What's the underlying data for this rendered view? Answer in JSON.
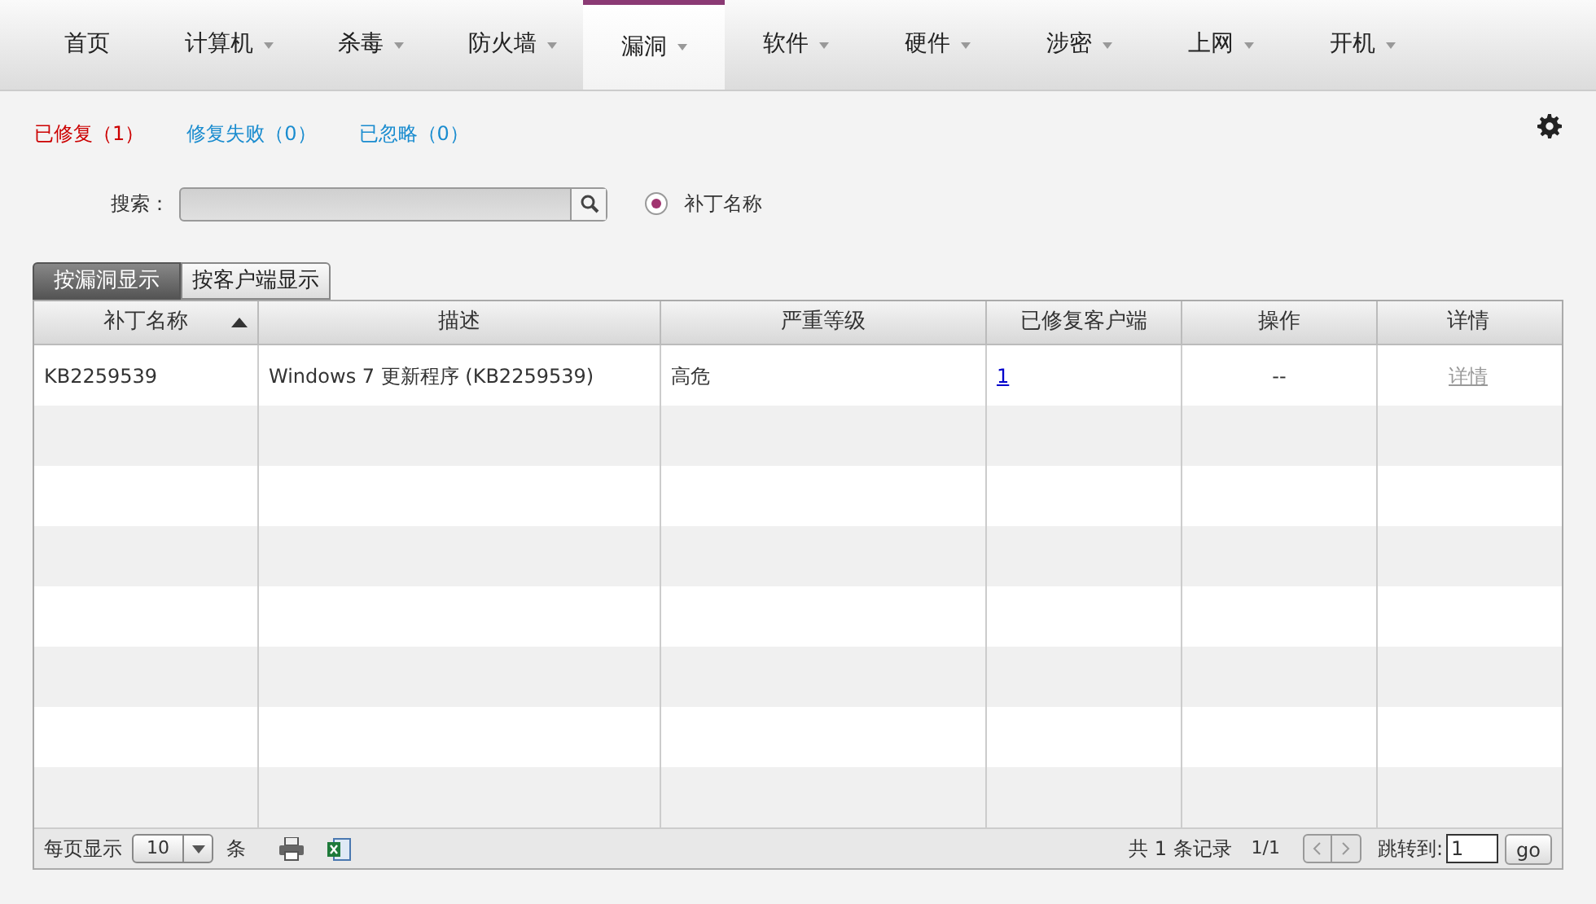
{
  "nav_tabs": [
    {
      "label": "首页",
      "dropdown": false,
      "selected": false
    },
    {
      "label": "计算机",
      "dropdown": true,
      "selected": false
    },
    {
      "label": "杀毒",
      "dropdown": true,
      "selected": false
    },
    {
      "label": "防火墙",
      "dropdown": true,
      "selected": false
    },
    {
      "label": "漏洞",
      "dropdown": true,
      "selected": true
    },
    {
      "label": "软件",
      "dropdown": true,
      "selected": false
    },
    {
      "label": "硬件",
      "dropdown": true,
      "selected": false
    },
    {
      "label": "涉密",
      "dropdown": true,
      "selected": false
    },
    {
      "label": "上网",
      "dropdown": true,
      "selected": false
    },
    {
      "label": "开机",
      "dropdown": true,
      "selected": false
    }
  ],
  "filters": [
    {
      "label": "已修复（1）",
      "selected": true
    },
    {
      "label": "修复失败（0）",
      "selected": false
    },
    {
      "label": "已忽略（0）",
      "selected": false
    }
  ],
  "search": {
    "label": "搜索：",
    "radio_label": "补丁名称",
    "radio_checked": true
  },
  "view_tabs": [
    {
      "label": "按漏洞显示",
      "selected": true
    },
    {
      "label": "按客户端显示",
      "selected": false
    }
  ],
  "table": {
    "columns": [
      {
        "label": "补丁名称",
        "sorted": true
      },
      {
        "label": "描述",
        "sorted": false
      },
      {
        "label": "严重等级",
        "sorted": false
      },
      {
        "label": "已修复客户端",
        "sorted": false
      },
      {
        "label": "操作",
        "sorted": false
      },
      {
        "label": "详情",
        "sorted": false
      }
    ],
    "rows": [
      {
        "patch": "KB2259539",
        "description": "Windows 7 更新程序 (KB2259539)",
        "severity": "高危",
        "fixed_clients": "1",
        "action": "--",
        "details": "详情"
      }
    ]
  },
  "footer": {
    "per_page_label": "每页显示",
    "per_page": "10",
    "per_page_unit": "条",
    "total": "共 1 条记录",
    "page": "1/1",
    "jump_label": "跳转到:",
    "jump_value": "1",
    "go": "go"
  }
}
